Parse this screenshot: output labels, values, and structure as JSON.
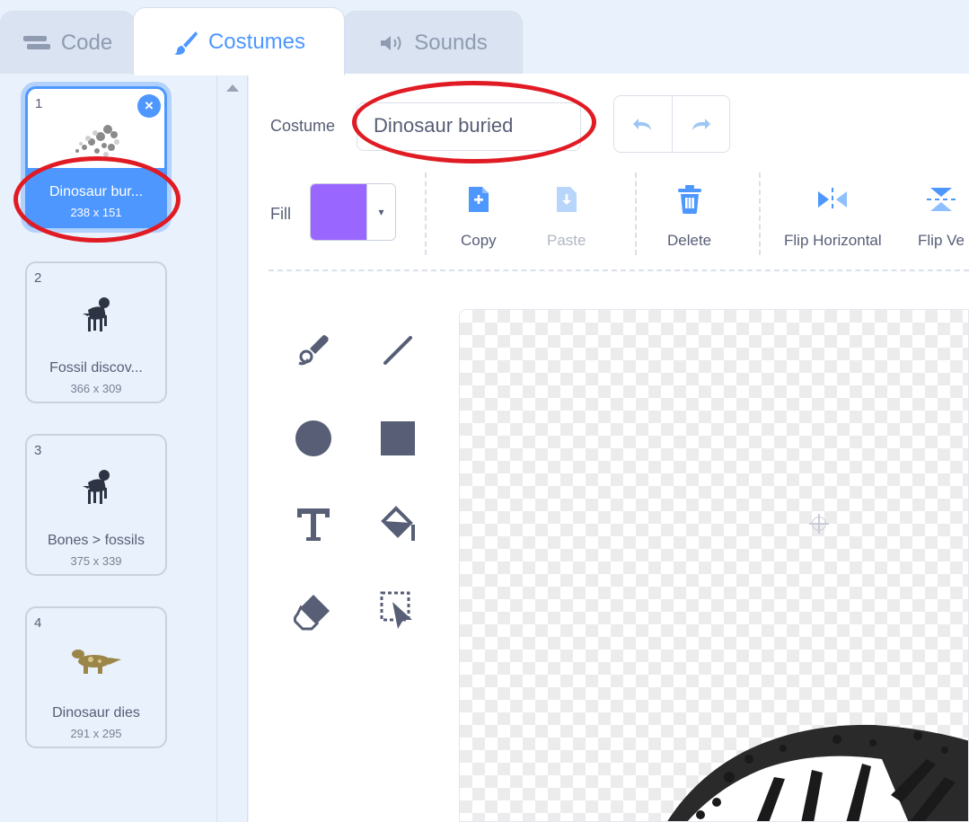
{
  "tabs": [
    {
      "label": "Code",
      "icon": "code-blocks-icon"
    },
    {
      "label": "Costumes",
      "icon": "paintbrush-icon"
    },
    {
      "label": "Sounds",
      "icon": "speaker-icon"
    }
  ],
  "costumes": [
    {
      "number": "1",
      "name": "Dinosaur bur...",
      "size": "238 x 151",
      "selected": true
    },
    {
      "number": "2",
      "name": "Fossil discov...",
      "size": "366 x 309"
    },
    {
      "number": "3",
      "name": "Bones > fossils",
      "size": "375 x 339"
    },
    {
      "number": "4",
      "name": "Dinosaur dies",
      "size": "291 x 295"
    }
  ],
  "editor": {
    "costume_label": "Costume",
    "costume_name": "Dinosaur buried",
    "fill_label": "Fill",
    "fill_color": "#9966ff",
    "actions": {
      "copy": "Copy",
      "paste": "Paste",
      "delete": "Delete",
      "flip_horizontal": "Flip Horizontal",
      "flip_vertical": "Flip Ve"
    }
  },
  "colors": {
    "accent": "#4d97ff",
    "annotation": "#e01b24",
    "tool_icon": "#575e75"
  }
}
